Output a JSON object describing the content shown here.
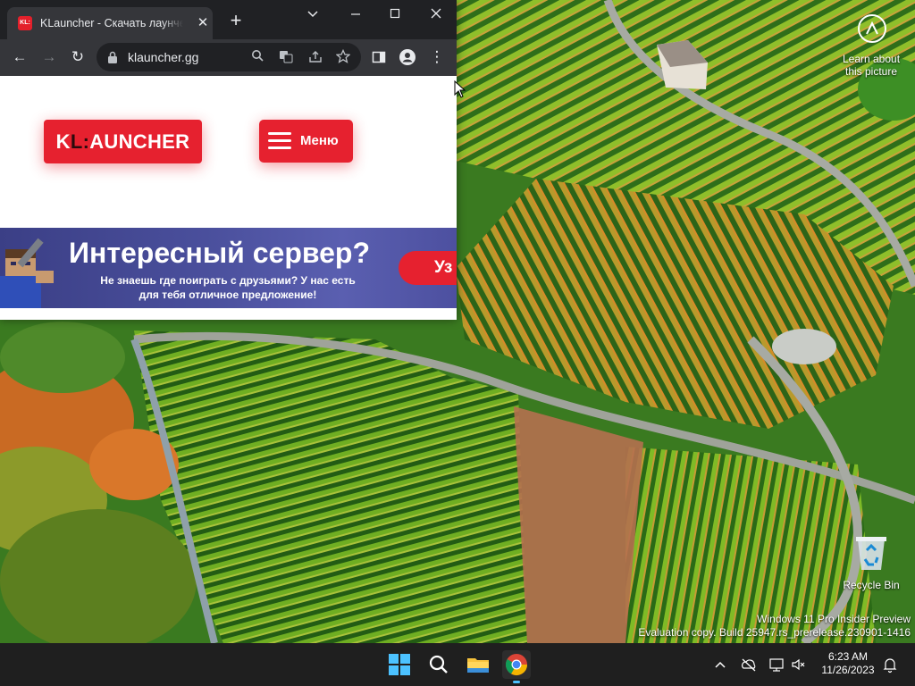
{
  "browser": {
    "tab_title": "KLauncher - Скачать лаунчер Майнкрафт",
    "favicon_text": "KL:",
    "url": "klauncher.gg"
  },
  "page": {
    "logo_text_1": "K",
    "logo_text_2": "L:",
    "logo_text_3": "AUNCHER",
    "menu_label": "Меню",
    "banner_title": "Интересный сервер?",
    "banner_subtitle": "Не знаешь где поиграть с друзьями? У нас есть для тебя отличное предложение!",
    "banner_button": "Уз"
  },
  "desktop": {
    "learn_about": "Learn about this picture",
    "recycle_bin": "Recycle Bin",
    "watermark_line1": "Windows 11 Pro Insider Preview",
    "watermark_line2": "Evaluation copy. Build 25947.rs_prerelease.230901-1416"
  },
  "taskbar": {
    "time": "6:23 AM",
    "date": "11/26/2023"
  },
  "colors": {
    "accent_red": "#e6212f",
    "chrome_dark": "#202124",
    "banner_blue": "#4a4f9c"
  }
}
